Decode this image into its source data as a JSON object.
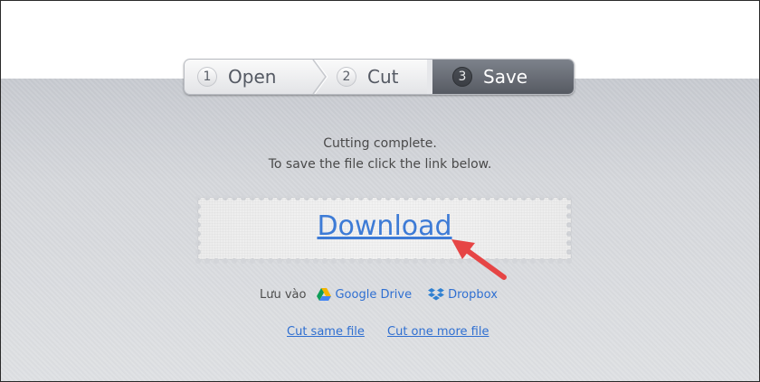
{
  "steps": [
    {
      "num": "1",
      "label": "Open"
    },
    {
      "num": "2",
      "label": "Cut"
    },
    {
      "num": "3",
      "label": "Save"
    }
  ],
  "message": {
    "line1": "Cutting complete.",
    "line2": "To save the file click the link below."
  },
  "download": {
    "label": "Download"
  },
  "save_to": {
    "label": "Lưu vào",
    "google_drive": "Google Drive",
    "dropbox": "Dropbox"
  },
  "links": {
    "cut_same": "Cut same file",
    "cut_more": "Cut one more file"
  },
  "colors": {
    "link": "#2f6fd1",
    "active_step": "#5e626a",
    "arrow": "#e64545"
  },
  "icons": {
    "google_drive": "google-drive-icon",
    "dropbox": "dropbox-icon"
  }
}
